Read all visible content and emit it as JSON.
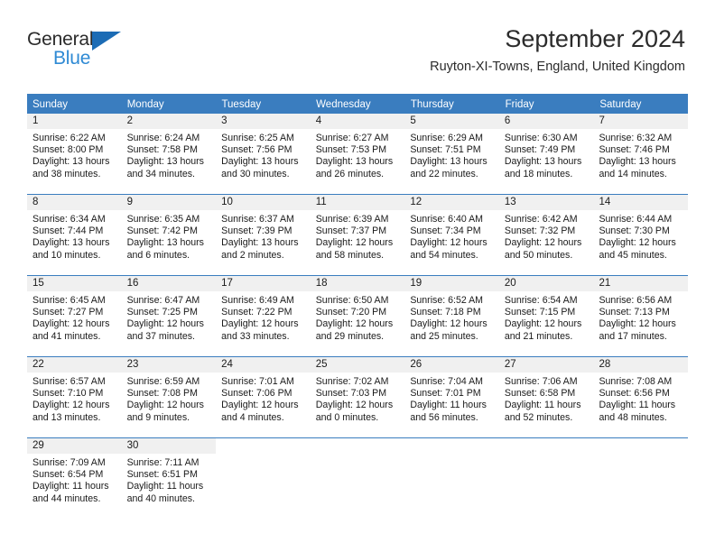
{
  "brand": {
    "name_top": "General",
    "name_bottom": "Blue",
    "accent_color": "#2f8ad4",
    "triangle_color": "#1c6cb5"
  },
  "header": {
    "title": "September 2024",
    "subtitle": "Ruyton-XI-Towns, England, United Kingdom"
  },
  "calendar": {
    "header_color": "#3a7dbf",
    "day_band_color": "#f0f0f0",
    "weekdays": [
      "Sunday",
      "Monday",
      "Tuesday",
      "Wednesday",
      "Thursday",
      "Friday",
      "Saturday"
    ],
    "weeks": [
      [
        {
          "day": "1",
          "sunrise": "Sunrise: 6:22 AM",
          "sunset": "Sunset: 8:00 PM",
          "daylight": "Daylight: 13 hours and 38 minutes."
        },
        {
          "day": "2",
          "sunrise": "Sunrise: 6:24 AM",
          "sunset": "Sunset: 7:58 PM",
          "daylight": "Daylight: 13 hours and 34 minutes."
        },
        {
          "day": "3",
          "sunrise": "Sunrise: 6:25 AM",
          "sunset": "Sunset: 7:56 PM",
          "daylight": "Daylight: 13 hours and 30 minutes."
        },
        {
          "day": "4",
          "sunrise": "Sunrise: 6:27 AM",
          "sunset": "Sunset: 7:53 PM",
          "daylight": "Daylight: 13 hours and 26 minutes."
        },
        {
          "day": "5",
          "sunrise": "Sunrise: 6:29 AM",
          "sunset": "Sunset: 7:51 PM",
          "daylight": "Daylight: 13 hours and 22 minutes."
        },
        {
          "day": "6",
          "sunrise": "Sunrise: 6:30 AM",
          "sunset": "Sunset: 7:49 PM",
          "daylight": "Daylight: 13 hours and 18 minutes."
        },
        {
          "day": "7",
          "sunrise": "Sunrise: 6:32 AM",
          "sunset": "Sunset: 7:46 PM",
          "daylight": "Daylight: 13 hours and 14 minutes."
        }
      ],
      [
        {
          "day": "8",
          "sunrise": "Sunrise: 6:34 AM",
          "sunset": "Sunset: 7:44 PM",
          "daylight": "Daylight: 13 hours and 10 minutes."
        },
        {
          "day": "9",
          "sunrise": "Sunrise: 6:35 AM",
          "sunset": "Sunset: 7:42 PM",
          "daylight": "Daylight: 13 hours and 6 minutes."
        },
        {
          "day": "10",
          "sunrise": "Sunrise: 6:37 AM",
          "sunset": "Sunset: 7:39 PM",
          "daylight": "Daylight: 13 hours and 2 minutes."
        },
        {
          "day": "11",
          "sunrise": "Sunrise: 6:39 AM",
          "sunset": "Sunset: 7:37 PM",
          "daylight": "Daylight: 12 hours and 58 minutes."
        },
        {
          "day": "12",
          "sunrise": "Sunrise: 6:40 AM",
          "sunset": "Sunset: 7:34 PM",
          "daylight": "Daylight: 12 hours and 54 minutes."
        },
        {
          "day": "13",
          "sunrise": "Sunrise: 6:42 AM",
          "sunset": "Sunset: 7:32 PM",
          "daylight": "Daylight: 12 hours and 50 minutes."
        },
        {
          "day": "14",
          "sunrise": "Sunrise: 6:44 AM",
          "sunset": "Sunset: 7:30 PM",
          "daylight": "Daylight: 12 hours and 45 minutes."
        }
      ],
      [
        {
          "day": "15",
          "sunrise": "Sunrise: 6:45 AM",
          "sunset": "Sunset: 7:27 PM",
          "daylight": "Daylight: 12 hours and 41 minutes."
        },
        {
          "day": "16",
          "sunrise": "Sunrise: 6:47 AM",
          "sunset": "Sunset: 7:25 PM",
          "daylight": "Daylight: 12 hours and 37 minutes."
        },
        {
          "day": "17",
          "sunrise": "Sunrise: 6:49 AM",
          "sunset": "Sunset: 7:22 PM",
          "daylight": "Daylight: 12 hours and 33 minutes."
        },
        {
          "day": "18",
          "sunrise": "Sunrise: 6:50 AM",
          "sunset": "Sunset: 7:20 PM",
          "daylight": "Daylight: 12 hours and 29 minutes."
        },
        {
          "day": "19",
          "sunrise": "Sunrise: 6:52 AM",
          "sunset": "Sunset: 7:18 PM",
          "daylight": "Daylight: 12 hours and 25 minutes."
        },
        {
          "day": "20",
          "sunrise": "Sunrise: 6:54 AM",
          "sunset": "Sunset: 7:15 PM",
          "daylight": "Daylight: 12 hours and 21 minutes."
        },
        {
          "day": "21",
          "sunrise": "Sunrise: 6:56 AM",
          "sunset": "Sunset: 7:13 PM",
          "daylight": "Daylight: 12 hours and 17 minutes."
        }
      ],
      [
        {
          "day": "22",
          "sunrise": "Sunrise: 6:57 AM",
          "sunset": "Sunset: 7:10 PM",
          "daylight": "Daylight: 12 hours and 13 minutes."
        },
        {
          "day": "23",
          "sunrise": "Sunrise: 6:59 AM",
          "sunset": "Sunset: 7:08 PM",
          "daylight": "Daylight: 12 hours and 9 minutes."
        },
        {
          "day": "24",
          "sunrise": "Sunrise: 7:01 AM",
          "sunset": "Sunset: 7:06 PM",
          "daylight": "Daylight: 12 hours and 4 minutes."
        },
        {
          "day": "25",
          "sunrise": "Sunrise: 7:02 AM",
          "sunset": "Sunset: 7:03 PM",
          "daylight": "Daylight: 12 hours and 0 minutes."
        },
        {
          "day": "26",
          "sunrise": "Sunrise: 7:04 AM",
          "sunset": "Sunset: 7:01 PM",
          "daylight": "Daylight: 11 hours and 56 minutes."
        },
        {
          "day": "27",
          "sunrise": "Sunrise: 7:06 AM",
          "sunset": "Sunset: 6:58 PM",
          "daylight": "Daylight: 11 hours and 52 minutes."
        },
        {
          "day": "28",
          "sunrise": "Sunrise: 7:08 AM",
          "sunset": "Sunset: 6:56 PM",
          "daylight": "Daylight: 11 hours and 48 minutes."
        }
      ],
      [
        {
          "day": "29",
          "sunrise": "Sunrise: 7:09 AM",
          "sunset": "Sunset: 6:54 PM",
          "daylight": "Daylight: 11 hours and 44 minutes."
        },
        {
          "day": "30",
          "sunrise": "Sunrise: 7:11 AM",
          "sunset": "Sunset: 6:51 PM",
          "daylight": "Daylight: 11 hours and 40 minutes."
        },
        {
          "day": "",
          "sunrise": "",
          "sunset": "",
          "daylight": ""
        },
        {
          "day": "",
          "sunrise": "",
          "sunset": "",
          "daylight": ""
        },
        {
          "day": "",
          "sunrise": "",
          "sunset": "",
          "daylight": ""
        },
        {
          "day": "",
          "sunrise": "",
          "sunset": "",
          "daylight": ""
        },
        {
          "day": "",
          "sunrise": "",
          "sunset": "",
          "daylight": ""
        }
      ]
    ]
  }
}
